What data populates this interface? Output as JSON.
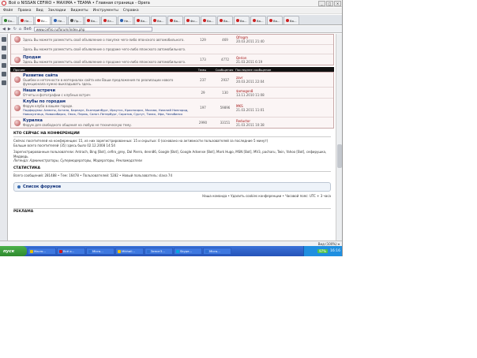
{
  "window": {
    "title": "Всё о NISSAN CEFIRO • MAXIMA • TEAMA • Главная страница - Opera"
  },
  "menu": [
    "Файл",
    "Правка",
    "Вид",
    "Закладки",
    "Виджеты",
    "Инструменты",
    "Справка"
  ],
  "tabs": [
    {
      "label": "Ва...",
      "color": "#2a7f2a"
    },
    {
      "label": "Не...",
      "color": "#c22"
    },
    {
      "label": "Вс...",
      "color": "#c22"
    },
    {
      "label": "Не...",
      "color": "#2a5fb0"
    },
    {
      "label": "Пр...",
      "color": "#555"
    },
    {
      "label": "Ва...",
      "color": "#c22"
    },
    {
      "label": "Вз...",
      "color": "#c22"
    },
    {
      "label": "Не...",
      "color": "#2a5fb0"
    },
    {
      "label": "Ва...",
      "color": "#c22"
    },
    {
      "label": "Ва...",
      "color": "#c22"
    },
    {
      "label": "Ва...",
      "color": "#c22"
    },
    {
      "label": "Фо...",
      "color": "#c22"
    },
    {
      "label": "Ва...",
      "color": "#c22"
    },
    {
      "label": "Ва...",
      "color": "#c22"
    },
    {
      "label": "Ва...",
      "color": "#c22"
    },
    {
      "label": "Ва...",
      "color": "#c22"
    },
    {
      "label": "Ва...",
      "color": "#c22"
    },
    {
      "label": "Ва...",
      "color": "#c22"
    }
  ],
  "address": {
    "url": "www.cefiro.ru/forum/index.php",
    "back_label": "Веб"
  },
  "top_forums": [
    {
      "desc": "Здесь Вы можете разместить своё объявление о покупке чего-либо японского автомобильного.",
      "topics": "129",
      "posts": "469",
      "last": "Qfrogm",
      "last_date": "20.03.2011 21:40"
    },
    {
      "desc": "Здесь Вы можете разместить своё объявление о продаже чего-либо японского автомобильного.",
      "topics": "",
      "posts": "",
      "last": "",
      "last_date": ""
    },
    {
      "title": "Продам",
      "desc": "Здесь Вы можете разместить своё объявление о продаже чего-либо японского автомобильного.",
      "topics": "173",
      "posts": "4772",
      "last": "Qerion",
      "last_date": "21.03.2011 6:19"
    }
  ],
  "section_header": {
    "name": "Прочее",
    "topics": "Темы",
    "posts": "Сообщения",
    "last": "Последнее сообщение"
  },
  "forums": [
    {
      "title": "Развитие сайта",
      "desc": "Ошибки и неточности в материалах сайта или Ваши предложения по реализации нового функционала нужно выкладывать здесь.",
      "topics": "237",
      "posts": "2937",
      "last": "zavr",
      "last_date": "20.03.2011 22:04"
    },
    {
      "title": "Наши встречи",
      "desc": "Отчеты и фотографии с клубных встреч",
      "topics": "29",
      "posts": "130",
      "last": "$amogon8",
      "last_date": "13.11.2010 11:08"
    },
    {
      "title": "Клубы по городам",
      "desc": "Форум клуба в вашем городе.",
      "subforums": "Подфорумы: Алматы, Астана, Барнаул, Екатеринбург, Иркутск, Красноярск, Москва, Нижний Новгород, Новокузнецк, Новосибирск, Омск, Пермь, Санкт-Петербург, Саратов, Сургут, Томск, Уфа, Челябинск",
      "topics": "197",
      "posts": "59896",
      "last": "MKS",
      "last_date": "21.03.2011 11:01"
    },
    {
      "title": "Курилка",
      "desc": "Форум для свободного общения на любую не техническую тему.",
      "topics": "2990",
      "posts": "33151",
      "last": "Reductor",
      "last_date": "21.03.2011 10:38"
    }
  ],
  "online": {
    "heading": "КТО СЕЙЧАС НА КОНФЕРЕНЦИИ",
    "line1": "Сейчас посетителей на конференции: 15, из них зарегистрированных: 15 и скрытых: 0 (основано на активности пользователей за последние 5 минут)",
    "line2": "Больше всего посетителей (35) здесь было 02.12.2008 14:54",
    "registered": "Зарегистрированные пользователи: Antrach, Bing [Bot], cefiro_grey, Dal Pierro, denn86, Google [Bot], Google Adsense [Bot], Mark Hugo, MSN [Bot], MV3, pacharu, Twin, Yahoo [Bot], сефирушка, Медведь",
    "legend": "Легенда: Администраторы, Супермодераторы, Модераторы, Рекламодатели"
  },
  "stats": {
    "heading": "СТАТИСТИКА",
    "text": "Всего сообщений: 281488 • Тем: 16478 • Пользователей: 5282 • Новый пользователь: slava 74"
  },
  "jumpbox": {
    "label": "Список форумов"
  },
  "footer": {
    "links": "Наша команда • Удалить cookies конференции • Часовой пояс: UTC + 3 часа"
  },
  "ads": {
    "heading": "РЕКЛАМА"
  },
  "status": {
    "zoom": "Вид (100%) ▾"
  },
  "taskbar": {
    "start": "пуск",
    "items": [
      {
        "label": "Macro...",
        "color": "#e8c000"
      },
      {
        "label": "Всё о...",
        "color": "#d0181e"
      },
      {
        "label": "Micro...",
        "color": "#2e6fd0"
      },
      {
        "label": "Mikhail...",
        "color": "#f0c000"
      },
      {
        "label": "Зенит3...",
        "color": "#2e6fd0"
      },
      {
        "label": "Skype...",
        "color": "#00a8e0"
      },
      {
        "label": "Micro...",
        "color": "#2e6fd0"
      }
    ],
    "battery": "97%",
    "clock": "16:16"
  }
}
